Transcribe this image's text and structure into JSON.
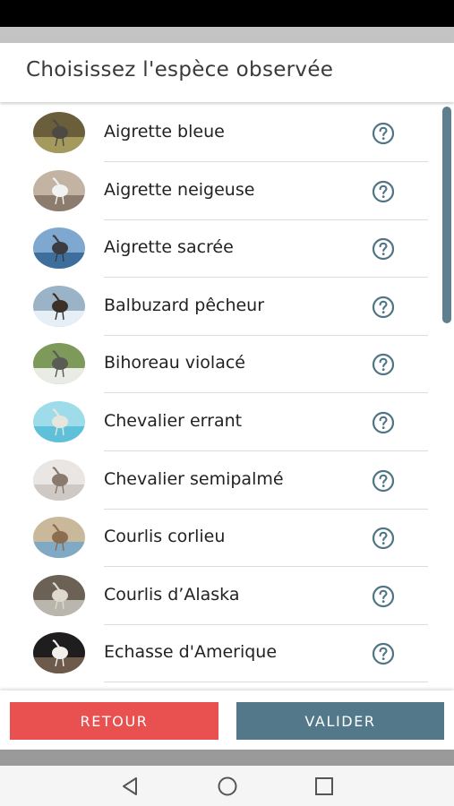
{
  "dialog": {
    "title": "Choisissez l'espèce observée"
  },
  "species": [
    {
      "name": "Aigrette bleue",
      "thumb_icon": "blue-heron-photo",
      "colors": [
        "#a49a5e",
        "#6a5f3a",
        "#4e4a43"
      ]
    },
    {
      "name": "Aigrette neigeuse",
      "thumb_icon": "snowy-egret-photo",
      "colors": [
        "#8b7c6e",
        "#c2b3a3",
        "#f2f2f2"
      ]
    },
    {
      "name": "Aigrette sacrée",
      "thumb_icon": "reef-egret-photo",
      "colors": [
        "#3e6f9c",
        "#7ea8cf",
        "#3b3b40"
      ]
    },
    {
      "name": "Balbuzard pêcheur",
      "thumb_icon": "osprey-photo",
      "colors": [
        "#e6eef6",
        "#9bb3c6",
        "#3c3129"
      ]
    },
    {
      "name": "Bihoreau violacé",
      "thumb_icon": "night-heron-photo",
      "colors": [
        "#e8ece4",
        "#7e9a5a",
        "#5a5b55"
      ]
    },
    {
      "name": "Chevalier errant",
      "thumb_icon": "wandering-tattler-photo",
      "colors": [
        "#5fc0d9",
        "#9fdcea",
        "#e6e6dc"
      ]
    },
    {
      "name": "Chevalier semipalmé",
      "thumb_icon": "willet-photo",
      "colors": [
        "#cfc9c6",
        "#e9e6e3",
        "#8a7a6e"
      ]
    },
    {
      "name": "Courlis corlieu",
      "thumb_icon": "whimbrel-photo",
      "colors": [
        "#7fa9c4",
        "#c9b89a",
        "#8d6d4f"
      ]
    },
    {
      "name": "Courlis d’Alaska",
      "thumb_icon": "bristle-thighed-curlew-photo",
      "colors": [
        "#b9b6ae",
        "#6b6155",
        "#dfd8cc"
      ]
    },
    {
      "name": "Echasse d'Amerique",
      "thumb_icon": "black-necked-stilt-photo",
      "colors": [
        "#6e5a4a",
        "#1f1d1d",
        "#f3f0ec"
      ]
    },
    {
      "name": "",
      "thumb_icon": "partial-photo",
      "colors": [
        "#b7a79a",
        "#e0d7cf",
        "#8c7a6c"
      ]
    }
  ],
  "footer": {
    "back_label": "RETOUR",
    "ok_label": "VALIDER"
  },
  "nav": {
    "back_icon": "triangle-back-icon",
    "home_icon": "circle-home-icon",
    "recents_icon": "square-recents-icon"
  },
  "theme": {
    "accent_red": "#e95050",
    "accent_slate": "#52788a",
    "help_icon_color": "#4f7585"
  }
}
